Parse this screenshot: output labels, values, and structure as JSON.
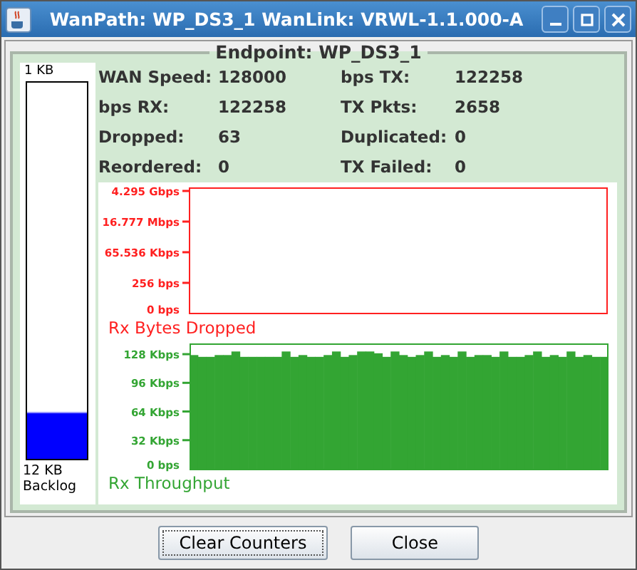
{
  "window": {
    "title": "WanPath: WP_DS3_1 WanLink:  VRWL-1.1.000-A"
  },
  "panel": {
    "title": "Endpoint: WP_DS3_1"
  },
  "backlog": {
    "top_label": "1 KB",
    "level": 0.12,
    "value": "12 KB",
    "label": "Backlog"
  },
  "stats": [
    {
      "label": "WAN Speed:",
      "value": "128000"
    },
    {
      "label": "bps TX:",
      "value": "122258"
    },
    {
      "label": "bps RX:",
      "value": "122258"
    },
    {
      "label": "TX Pkts:",
      "value": "2658"
    },
    {
      "label": "Dropped:",
      "value": "63"
    },
    {
      "label": "Duplicated:",
      "value": "0"
    },
    {
      "label": "Reordered:",
      "value": "0"
    },
    {
      "label": "TX Failed:",
      "value": "0"
    }
  ],
  "charts": [
    {
      "kind": "empty",
      "color": "#ff2020",
      "title": "Rx Bytes Dropped",
      "tick_labels": [
        "4.295 Gbps",
        "16.777 Mbps",
        "65.536 Kbps",
        "256 bps",
        "0 bps"
      ]
    },
    {
      "kind": "bar",
      "color": "#33a533",
      "chart_data": {
        "type": "bar",
        "title": "Rx Throughput",
        "ylim": [
          0,
          140
        ],
        "yticks": [
          {
            "value": 0,
            "label": "0 bps"
          },
          {
            "value": 32,
            "label": "32 Kbps"
          },
          {
            "value": 64,
            "label": "64 Kbps"
          },
          {
            "value": 96,
            "label": "96 Kbps"
          },
          {
            "value": 128,
            "label": "128 Kbps"
          }
        ],
        "series": [
          {
            "color": "#33a533",
            "values": [
              127,
              125,
              125,
              127,
              127,
              131,
              125,
              125,
              125,
              125,
              125,
              131,
              125,
              127,
              125,
              125,
              127,
              131,
              125,
              127,
              131,
              131,
              129,
              125,
              131,
              127,
              125,
              127,
              131,
              125,
              127,
              125,
              131,
              125,
              127,
              127,
              125,
              131,
              125,
              125,
              127,
              131,
              125,
              127,
              125,
              131,
              125,
              127,
              125,
              125
            ]
          }
        ]
      }
    }
  ],
  "buttons": [
    {
      "label": "Clear Counters",
      "selected": true
    },
    {
      "label": "Close",
      "selected": false
    }
  ]
}
